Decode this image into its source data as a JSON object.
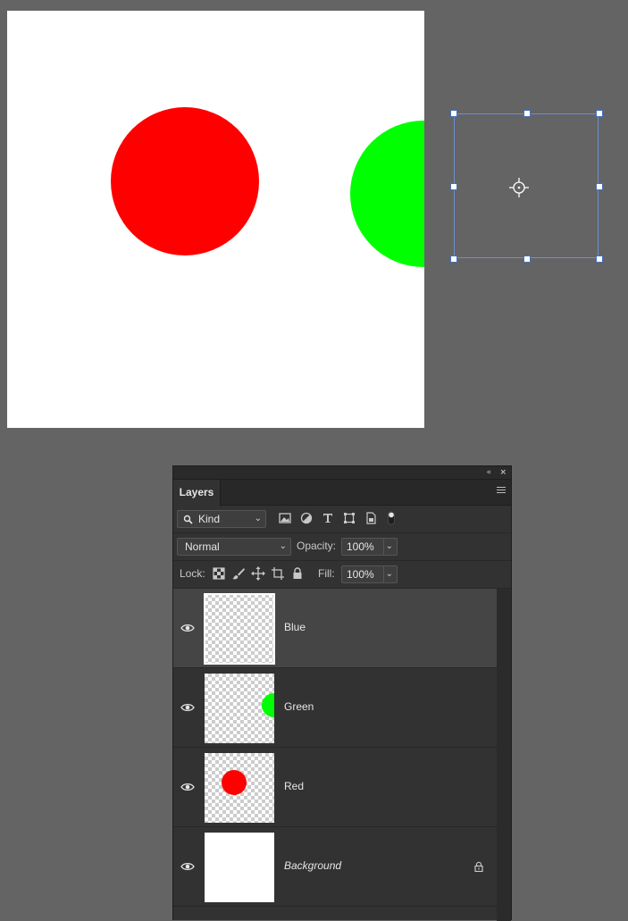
{
  "canvas": {
    "background": "#ffffff",
    "circles": [
      {
        "name": "red-circle",
        "color": "#ff0000"
      },
      {
        "name": "green-circle",
        "color": "#00ff00"
      }
    ]
  },
  "layers_panel": {
    "tab_label": "Layers",
    "filter": {
      "selected": "Kind",
      "icons": [
        "image-filter-icon",
        "adjustment-filter-icon",
        "type-filter-icon",
        "shape-filter-icon",
        "smart-object-filter-icon",
        "filter-toggle-icon"
      ]
    },
    "blend_mode": "Normal",
    "opacity_label": "Opacity:",
    "opacity_value": "100%",
    "lock_label": "Lock:",
    "lock_icons": [
      "lock-transparent-icon",
      "lock-image-icon",
      "lock-position-icon",
      "lock-artboard-icon",
      "lock-all-icon"
    ],
    "fill_label": "Fill:",
    "fill_value": "100%",
    "layers": [
      {
        "name": "Blue",
        "selected": true,
        "thumb": "empty"
      },
      {
        "name": "Green",
        "selected": false,
        "thumb": "green",
        "color": "#00ff00"
      },
      {
        "name": "Red",
        "selected": false,
        "thumb": "red",
        "color": "#ff0000"
      },
      {
        "name": "Background",
        "selected": false,
        "thumb": "white",
        "locked": true
      }
    ]
  }
}
